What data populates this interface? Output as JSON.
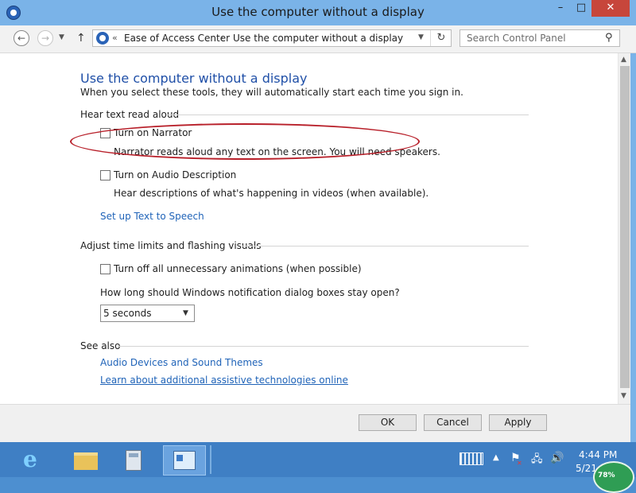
{
  "window": {
    "title": "Use the computer without a display",
    "minimize_glyph": "–",
    "maximize_glyph": "□",
    "close_glyph": "✕"
  },
  "nav": {
    "back_glyph": "←",
    "forward_glyph": "→",
    "recent_glyph": "▼",
    "up_glyph": "↑"
  },
  "address": {
    "prefix_glyph": "«",
    "crumb1": "Ease of Access Center",
    "separator": "›",
    "crumb2": "Use the computer without a display",
    "dropdown_glyph": "▼",
    "refresh_glyph": "↻"
  },
  "search": {
    "placeholder": "Search Control Panel",
    "icon_glyph": "⚲"
  },
  "main": {
    "title": "Use the computer without a display",
    "subtitle": "When you select these tools, they will automatically start each time you sign in.",
    "sections": {
      "hear_text": {
        "header": "Hear text read aloud",
        "narrator_label": "Turn on Narrator",
        "narrator_checked": false,
        "narrator_desc": "Narrator reads aloud any text on the screen. You will need speakers.",
        "audio_desc_label": "Turn on Audio Description",
        "audio_desc_checked": false,
        "audio_desc_desc": "Hear descriptions of what's happening in videos (when available).",
        "tts_link": "Set up Text to Speech"
      },
      "time_limits": {
        "header": "Adjust time limits and flashing visuals",
        "animations_label": "Turn off all unnecessary animations (when possible)",
        "animations_checked": false,
        "notification_question": "How long should Windows notification dialog boxes stay open?",
        "notification_value": "5 seconds",
        "dropdown_glyph": "▼"
      },
      "see_also": {
        "header": "See also",
        "link1": "Audio Devices and Sound Themes",
        "link2": "Learn about additional assistive technologies online"
      }
    }
  },
  "buttons": {
    "ok": "OK",
    "cancel": "Cancel",
    "apply": "Apply"
  },
  "scrollbar": {
    "up_glyph": "▲",
    "down_glyph": "▼"
  },
  "taskbar": {
    "ie_glyph": "e",
    "tray_arrow_glyph": "▲",
    "flag_glyph": "⚑",
    "flag_x_glyph": "✕",
    "network_glyph": "🖧",
    "volume_glyph": "🔊",
    "time": "4:44 PM",
    "date": "5/21",
    "badge_text": "78%"
  },
  "icons": {
    "app": "ease-of-access-icon",
    "internet_explorer": "internet-explorer-icon",
    "file_explorer": "file-explorer-icon",
    "calculator": "calculator-icon",
    "control_panel": "control-panel-icon",
    "touch_keyboard": "touch-keyboard-icon"
  },
  "colors": {
    "title_bar": "#7ab3e8",
    "close_button": "#c7463b",
    "page_title": "#1f4fa7",
    "link": "#1f63b8",
    "highlight_ellipse": "#b8202a",
    "taskbar": "#3f7fc4"
  }
}
